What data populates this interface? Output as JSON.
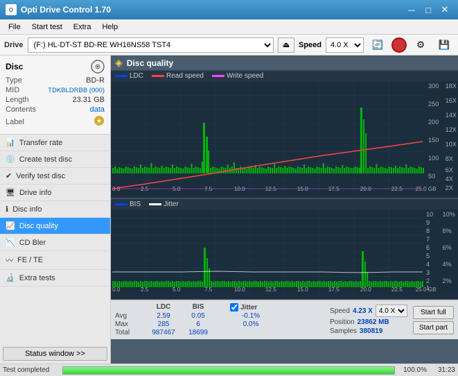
{
  "titleBar": {
    "title": "Opti Drive Control 1.70",
    "minimizeIcon": "─",
    "maximizeIcon": "□",
    "closeIcon": "✕"
  },
  "menuBar": {
    "items": [
      "File",
      "Start test",
      "Extra",
      "Help"
    ]
  },
  "driveBar": {
    "label": "Drive",
    "driveValue": "(F:)  HL-DT-ST BD-RE  WH16NS58 TST4",
    "speedLabel": "Speed",
    "speedValue": "4.0 X"
  },
  "disc": {
    "title": "Disc",
    "fields": [
      {
        "key": "Type",
        "value": "BD-R",
        "style": "normal"
      },
      {
        "key": "MID",
        "value": "TDKBLDRBB (000)",
        "style": "blue"
      },
      {
        "key": "Length",
        "value": "23.31 GB",
        "style": "normal"
      },
      {
        "key": "Contents",
        "value": "data",
        "style": "data"
      },
      {
        "key": "Label",
        "value": "",
        "style": "normal"
      }
    ]
  },
  "navItems": [
    {
      "label": "Transfer rate",
      "active": false
    },
    {
      "label": "Create test disc",
      "active": false
    },
    {
      "label": "Verify test disc",
      "active": false
    },
    {
      "label": "Drive info",
      "active": false
    },
    {
      "label": "Disc info",
      "active": false
    },
    {
      "label": "Disc quality",
      "active": true
    },
    {
      "label": "CD Bler",
      "active": false
    },
    {
      "label": "FE / TE",
      "active": false
    },
    {
      "label": "Extra tests",
      "active": false
    }
  ],
  "statusBtn": "Status window >>",
  "discQuality": {
    "title": "Disc quality",
    "legend": {
      "ldc": "LDC",
      "readSpeed": "Read speed",
      "writeSpeed": "Write speed",
      "bis": "BIS",
      "jitter": "Jitter"
    },
    "topChart": {
      "yMax": 300,
      "yLabels": [
        "300",
        "250",
        "200",
        "150",
        "100",
        "50"
      ],
      "xLabels": [
        "0.0",
        "2.5",
        "5.0",
        "7.5",
        "10.0",
        "12.5",
        "15.0",
        "17.5",
        "20.0",
        "22.5",
        "25.0 GB"
      ],
      "yRight": [
        "18X",
        "16X",
        "14X",
        "12X",
        "10X",
        "8X",
        "6X",
        "4X",
        "2X"
      ]
    },
    "bottomChart": {
      "yMax": 10,
      "yLabels": [
        "10",
        "9",
        "8",
        "7",
        "6",
        "5",
        "4",
        "3",
        "2",
        "1"
      ],
      "xLabels": [
        "0.0",
        "2.5",
        "5.0",
        "7.5",
        "10.0",
        "12.5",
        "15.0",
        "17.5",
        "20.0",
        "22.5",
        "25.0 GB"
      ],
      "yRight": [
        "10%",
        "8%",
        "6%",
        "4%",
        "2%"
      ]
    }
  },
  "stats": {
    "headers": [
      "",
      "LDC",
      "BIS",
      "",
      "Jitter"
    ],
    "rows": [
      {
        "label": "Avg",
        "ldc": "2.59",
        "bis": "0.05",
        "jitter": "-0.1%"
      },
      {
        "label": "Max",
        "ldc": "285",
        "bis": "6",
        "jitter": "0.0%"
      },
      {
        "label": "Total",
        "ldc": "987467",
        "bis": "18699",
        "jitter": ""
      }
    ],
    "speed": {
      "speedLabel": "Speed",
      "speedValue": "4.23 X",
      "speedSelect": "4.0 X",
      "positionLabel": "Position",
      "positionValue": "23862 MB",
      "samplesLabel": "Samples",
      "samplesValue": "380819"
    },
    "buttons": {
      "startFull": "Start full",
      "startPart": "Start part"
    }
  },
  "progressBar": {
    "percent": 100,
    "label": "100.0%",
    "time": "31:23",
    "status": "Test completed"
  }
}
